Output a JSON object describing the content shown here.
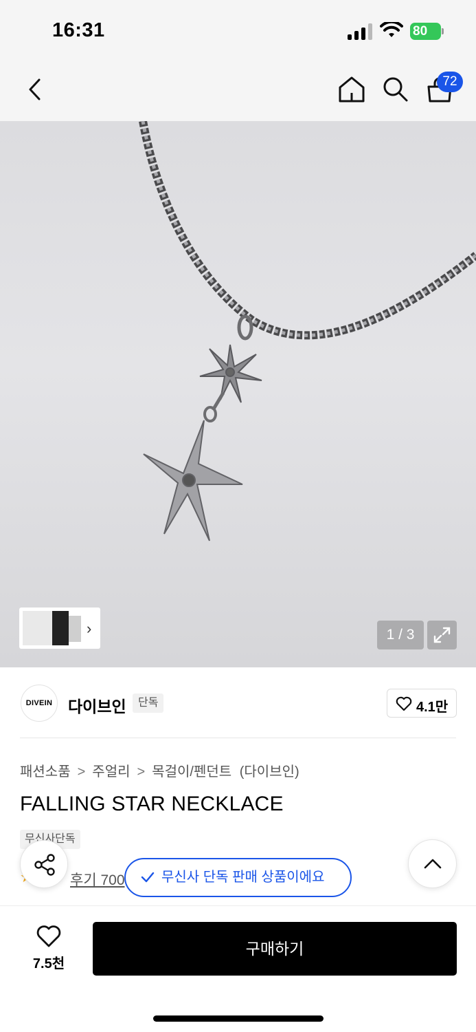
{
  "status_bar": {
    "time": "16:31",
    "battery": "80",
    "icons": [
      "signal-icon",
      "wifi-icon",
      "battery-icon"
    ]
  },
  "nav": {
    "icons": [
      "back-icon",
      "home-icon",
      "search-icon",
      "cart-icon"
    ],
    "cart_count": "72"
  },
  "gallery": {
    "page_counter": "1 / 3",
    "thumbnail_arrow": "›",
    "icons": [
      "expand-icon"
    ]
  },
  "brand": {
    "logo_text": "DIVEIN",
    "name": "다이브인",
    "tag": "단독",
    "like_count": "4.1만"
  },
  "breadcrumb": {
    "items": [
      "패션소품",
      "주얼리",
      "목걸이/펜던트"
    ],
    "separator": ">",
    "brand_suffix": "(다이브인)"
  },
  "product": {
    "title": "FALLING STAR NECKLACE",
    "exclusive_tag": "무신사단독",
    "rating_visible": "★",
    "review_text": "후기 700"
  },
  "toast": {
    "message": "무신사 단독 판매 상품이에요"
  },
  "bottom_bar": {
    "wish_count": "7.5천",
    "buy_label": "구매하기"
  },
  "colors": {
    "accent_blue": "#1a55e8",
    "battery_green": "#34c759",
    "buy_button": "#000000",
    "star": "#f3a712"
  }
}
